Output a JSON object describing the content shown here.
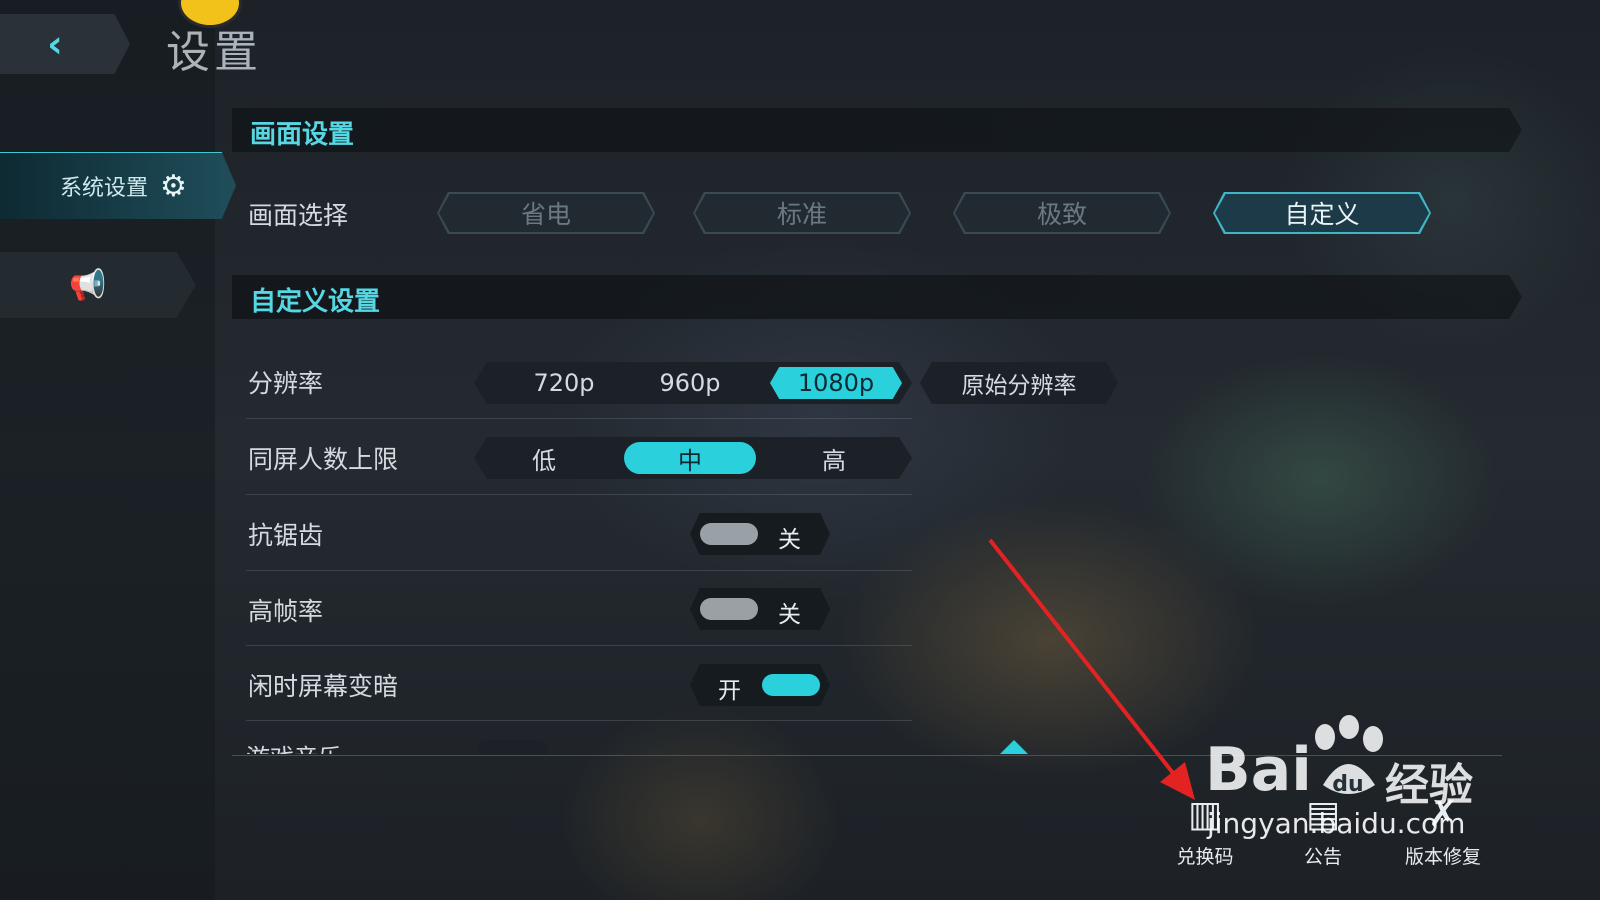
{
  "header": {
    "back_label": "‹",
    "title": "设置"
  },
  "sidebar": {
    "items": [
      {
        "label": "系统设置",
        "icon": "gears-icon",
        "active": true
      },
      {
        "label": "",
        "icon": "megaphone-icon",
        "active": false
      }
    ]
  },
  "graphics": {
    "section_title": "画面设置",
    "row_label": "画面选择",
    "options": [
      "省电",
      "标准",
      "极致",
      "自定义"
    ],
    "selected": "自定义"
  },
  "custom": {
    "section_title": "自定义设置",
    "resolution": {
      "label": "分辨率",
      "options": [
        "720p",
        "960p",
        "1080p"
      ],
      "selected": "1080p",
      "extra": "原始分辨率"
    },
    "players": {
      "label": "同屏人数上限",
      "options": [
        "低",
        "中",
        "高"
      ],
      "selected": "中"
    },
    "antialias": {
      "label": "抗锯齿",
      "state": "关"
    },
    "high_fps": {
      "label": "高帧率",
      "state": "关"
    },
    "dim": {
      "label": "闲时屏幕变暗",
      "state": "开"
    },
    "partial_label": "游戏音乐"
  },
  "bottom": {
    "redeem": {
      "label": "兑换码",
      "icon": "barcode-icon"
    },
    "notice": {
      "label": "公告",
      "icon": "notice-icon"
    },
    "repair": {
      "label": "版本修复",
      "icon": "wrench-icon"
    }
  },
  "watermark": {
    "bai": "Bai",
    "du": "du",
    "cn": "经验",
    "url": "jingyan.baidu.com"
  },
  "colors": {
    "accent": "#2ad0dc",
    "highlight": "#55d8e4",
    "arrow": "#e32222"
  }
}
